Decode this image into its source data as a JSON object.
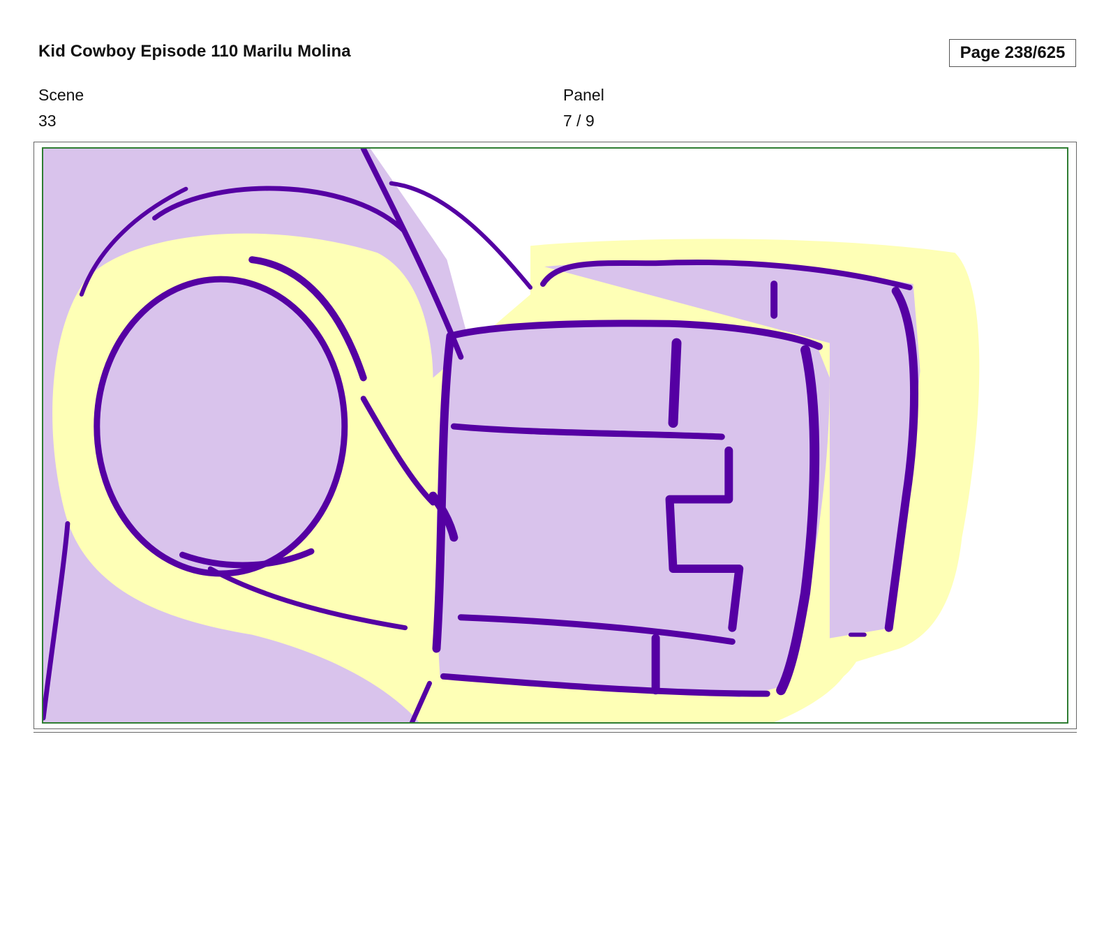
{
  "header": {
    "title": "Kid Cowboy Episode 110 Marilu Molina",
    "page_counter": "Page 238/625"
  },
  "meta": {
    "scene_label": "Scene",
    "scene_value": "33",
    "panel_label": "Panel",
    "panel_value": "7 / 9"
  },
  "panel": {
    "colors": {
      "fill": "#d9c3ec",
      "stroke": "#5500a3",
      "highlight": "#feffb6",
      "frame": "#2e7d32"
    }
  }
}
